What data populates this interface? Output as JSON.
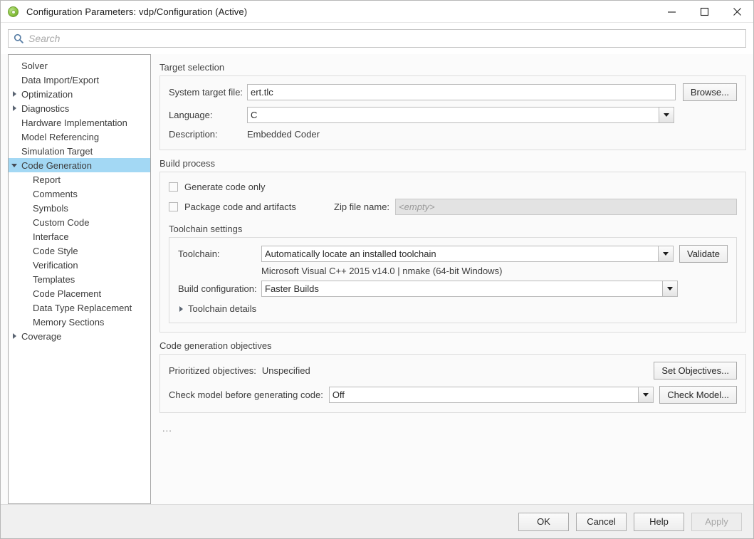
{
  "window": {
    "title": "Configuration Parameters: vdp/Configuration (Active)",
    "app_icon": "simulink-icon",
    "minimize": "minimize-icon",
    "maximize": "maximize-icon",
    "close": "close-icon"
  },
  "search": {
    "placeholder": "Search",
    "value": "",
    "icon": "search-icon"
  },
  "tree": {
    "selected": "Code Generation",
    "items": [
      {
        "label": "Solver",
        "level": 0,
        "arrow": "none"
      },
      {
        "label": "Data Import/Export",
        "level": 0,
        "arrow": "none"
      },
      {
        "label": "Optimization",
        "level": 0,
        "arrow": "collapsed"
      },
      {
        "label": "Diagnostics",
        "level": 0,
        "arrow": "collapsed"
      },
      {
        "label": "Hardware Implementation",
        "level": 0,
        "arrow": "none"
      },
      {
        "label": "Model Referencing",
        "level": 0,
        "arrow": "none"
      },
      {
        "label": "Simulation Target",
        "level": 0,
        "arrow": "none"
      },
      {
        "label": "Code Generation",
        "level": 0,
        "arrow": "expanded",
        "selected": true
      },
      {
        "label": "Report",
        "level": 1,
        "arrow": "none"
      },
      {
        "label": "Comments",
        "level": 1,
        "arrow": "none"
      },
      {
        "label": "Symbols",
        "level": 1,
        "arrow": "none"
      },
      {
        "label": "Custom Code",
        "level": 1,
        "arrow": "none"
      },
      {
        "label": "Interface",
        "level": 1,
        "arrow": "none"
      },
      {
        "label": "Code Style",
        "level": 1,
        "arrow": "none"
      },
      {
        "label": "Verification",
        "level": 1,
        "arrow": "none"
      },
      {
        "label": "Templates",
        "level": 1,
        "arrow": "none"
      },
      {
        "label": "Code Placement",
        "level": 1,
        "arrow": "none"
      },
      {
        "label": "Data Type Replacement",
        "level": 1,
        "arrow": "none"
      },
      {
        "label": "Memory Sections",
        "level": 1,
        "arrow": "none"
      },
      {
        "label": "Coverage",
        "level": 0,
        "arrow": "collapsed"
      }
    ]
  },
  "target_selection": {
    "title": "Target selection",
    "system_target_file_label": "System target file:",
    "system_target_file_value": "ert.tlc",
    "browse_label": "Browse...",
    "language_label": "Language:",
    "language_value": "C",
    "description_label": "Description:",
    "description_value": "Embedded Coder"
  },
  "build_process": {
    "title": "Build process",
    "generate_code_only_label": "Generate code only",
    "generate_code_only_checked": false,
    "package_code_label": "Package code and artifacts",
    "package_code_checked": false,
    "zip_file_name_label": "Zip file name:",
    "zip_file_name_placeholder": "<empty>",
    "zip_file_name_disabled": true,
    "toolchain_settings_title": "Toolchain settings",
    "toolchain_label": "Toolchain:",
    "toolchain_value": "Automatically locate an installed toolchain",
    "validate_label": "Validate",
    "toolchain_description": "Microsoft Visual C++ 2015 v14.0 | nmake (64-bit Windows)",
    "build_configuration_label": "Build configuration:",
    "build_configuration_value": "Faster Builds",
    "toolchain_details_label": "Toolchain details",
    "toolchain_details_expanded": false
  },
  "code_generation_objectives": {
    "title": "Code generation objectives",
    "prioritized_objectives_label": "Prioritized objectives:",
    "prioritized_objectives_value": "Unspecified",
    "set_objectives_label": "Set Objectives...",
    "check_model_label": "Check model before generating code:",
    "check_model_value": "Off",
    "check_model_button_label": "Check Model...",
    "overflow_indicator": "..."
  },
  "footer": {
    "ok_label": "OK",
    "cancel_label": "Cancel",
    "help_label": "Help",
    "apply_label": "Apply",
    "apply_enabled": false
  }
}
